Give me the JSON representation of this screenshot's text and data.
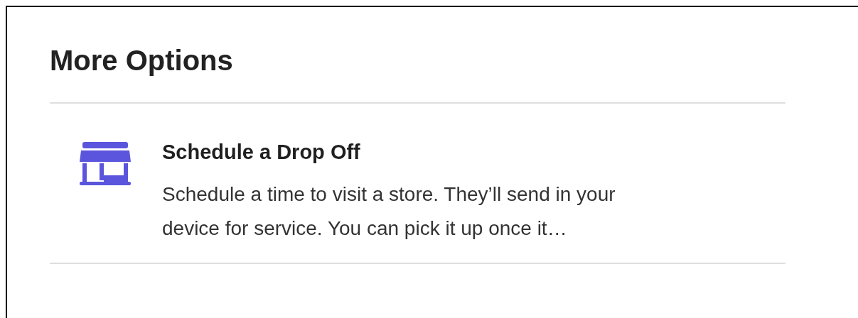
{
  "section": {
    "title": "More Options"
  },
  "options": [
    {
      "kind": "store",
      "title": "Schedule a Drop Off",
      "description": "Schedule a time to visit a store. They’ll send in your device for service. You can pick it up once it…"
    }
  ]
}
